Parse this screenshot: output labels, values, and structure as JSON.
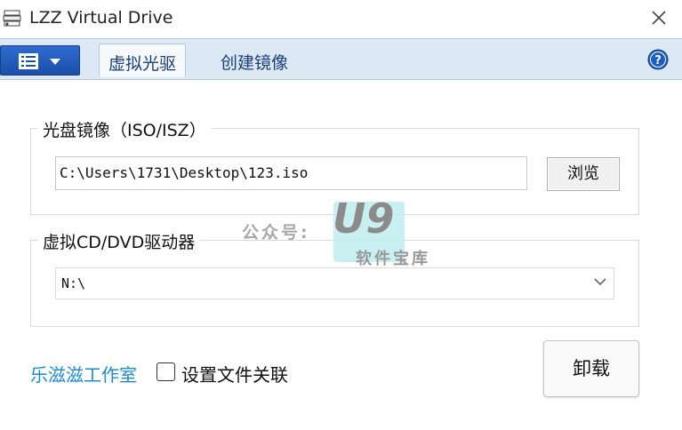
{
  "window": {
    "title": "LZZ Virtual Drive"
  },
  "tabs": [
    {
      "label": "虚拟光驱",
      "active": true
    },
    {
      "label": "创建镜像",
      "active": false
    }
  ],
  "image_group": {
    "legend": "光盘镜像（ISO/ISZ）",
    "path_value": "C:\\Users\\1731\\Desktop\\123.iso",
    "browse_label": "浏览"
  },
  "drive_group": {
    "legend": "虚拟CD/DVD驱动器",
    "selected_drive": "N:\\"
  },
  "footer": {
    "studio_link": "乐滋滋工作室",
    "file_assoc_label": "设置文件关联",
    "file_assoc_checked": false,
    "unmount_label": "卸载"
  },
  "watermark": {
    "prefix": "公众号:",
    "brand": "U9",
    "suffix": "软件宝库"
  },
  "colors": {
    "accent_blue": "#1b4fa8",
    "tabbar_bg": "#dde8f5",
    "link_blue": "#1e8ad6"
  }
}
